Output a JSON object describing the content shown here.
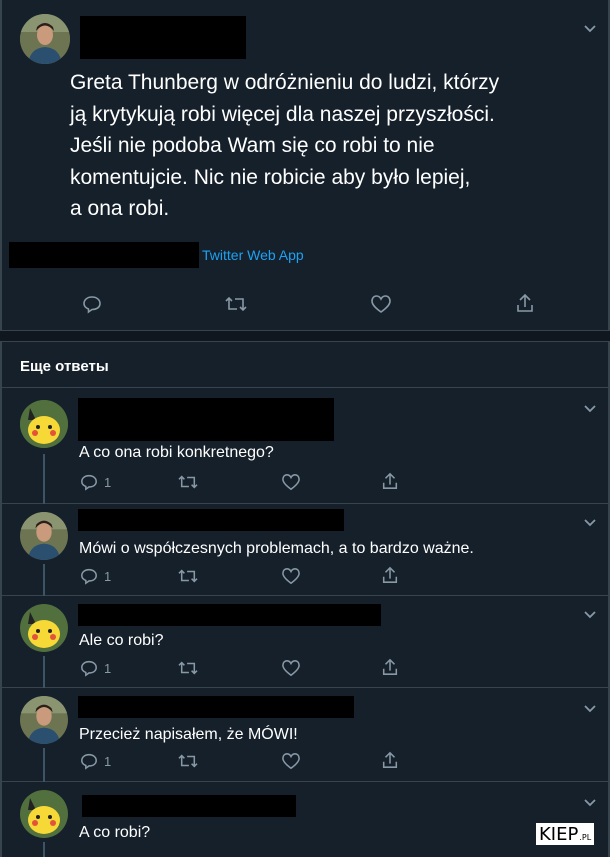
{
  "main_tweet": {
    "text": "Greta Thunberg w odróżnieniu do ludzi, którzy\nją krytykują robi więcej dla naszej przyszłości.\nJeśli nie podoba Wam się co robi to nie\nkomentujcie. Nic nie robicie aby było lepiej,\na ona robi.",
    "source": "Twitter Web App"
  },
  "more_replies": {
    "title": "Еще ответы"
  },
  "replies": [
    {
      "text": "A co ona robi konkretnego?",
      "reply_count": "1",
      "avatar": "pikachu"
    },
    {
      "text": "Mówi o współczesnych problemach, a to bardzo ważne.",
      "reply_count": "1",
      "avatar": "person"
    },
    {
      "text": "Ale co robi?",
      "reply_count": "1",
      "avatar": "pikachu"
    },
    {
      "text": "Przecież napisałem, że MÓWI!",
      "reply_count": "1",
      "avatar": "person"
    },
    {
      "text": "A co robi?",
      "reply_count": "",
      "avatar": "pikachu"
    }
  ],
  "watermark": {
    "main": "KIEP",
    "suffix": ".PL"
  },
  "icons": [
    "reply-icon",
    "retweet-icon",
    "like-icon",
    "share-icon",
    "chevron-down-icon"
  ],
  "colors": {
    "background": "#15202b",
    "text": "#ffffff",
    "muted": "#8899a6",
    "link": "#1da1f2",
    "border": "#38444d"
  }
}
